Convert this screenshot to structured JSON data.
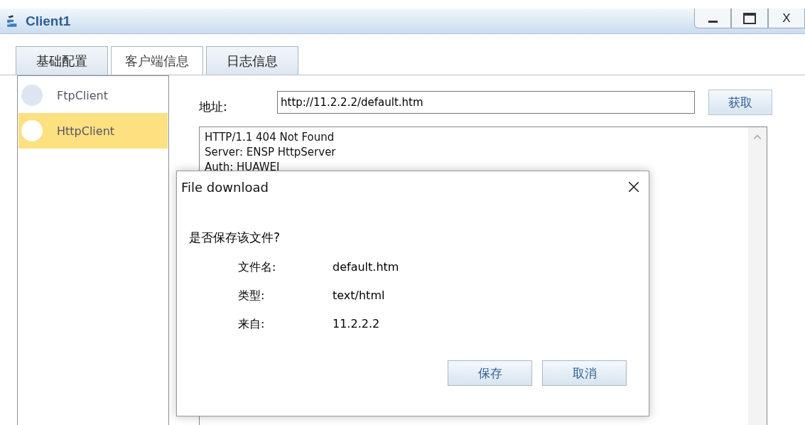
{
  "window": {
    "title": "Client1",
    "controls": [
      {
        "kind": "minimize"
      },
      {
        "kind": "maximize"
      },
      {
        "kind": "close",
        "label": "X"
      }
    ]
  },
  "tabs": [
    {
      "label": "基础配置",
      "selected": false
    },
    {
      "label": "客户端信息",
      "selected": true
    },
    {
      "label": "日志信息",
      "selected": false
    }
  ],
  "client_list": [
    {
      "label": "FtpClient",
      "selected": false
    },
    {
      "label": "HttpClient",
      "selected": true
    }
  ],
  "address": {
    "label": "地址:",
    "value": "http://11.2.2.2/default.htm"
  },
  "fetch_button": "获取",
  "response_lines": [
    "HTTP/1.1 404 Not Found",
    "Server: ENSP HttpServer",
    "Auth: HUAWEI"
  ],
  "dialog": {
    "title": "File download",
    "question": "是否保存该文件?",
    "fields": [
      {
        "label": "文件名:",
        "value": "default.htm"
      },
      {
        "label": "类型:",
        "value": "text/html"
      },
      {
        "label": "来自:",
        "value": "11.2.2.2"
      }
    ],
    "buttons": [
      "保存",
      "取消"
    ]
  }
}
